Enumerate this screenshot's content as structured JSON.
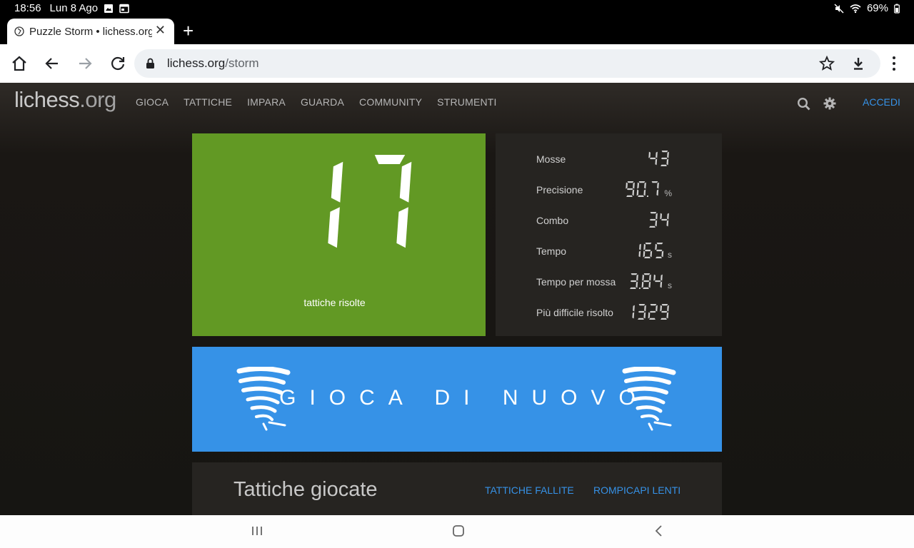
{
  "status_bar": {
    "time": "18:56",
    "date": "Lun 8 Ago",
    "battery": "69%"
  },
  "browser": {
    "tab_title": "Puzzle Storm • lichess.org",
    "url_host": "lichess.org",
    "url_path": "/storm"
  },
  "site": {
    "logo_main": "lichess",
    "logo_tld": ".org",
    "nav": [
      "GIOCA",
      "TATTICHE",
      "IMPARA",
      "GUARDA",
      "COMMUNITY",
      "STRUMENTI"
    ],
    "login": "ACCEDI"
  },
  "score": {
    "value": 17,
    "label": "tattiche risolte",
    "color": "#629924"
  },
  "stats": [
    {
      "label": "Mosse",
      "value": "43",
      "unit": ""
    },
    {
      "label": "Precisione",
      "value": "90.7",
      "unit": "%"
    },
    {
      "label": "Combo",
      "value": "34",
      "unit": ""
    },
    {
      "label": "Tempo",
      "value": "165",
      "unit": "s"
    },
    {
      "label": "Tempo per mossa",
      "value": "3.84",
      "unit": "s"
    },
    {
      "label": "Più difficile risolto",
      "value": "1329",
      "unit": ""
    }
  ],
  "play_again": {
    "label": "GIOCA DI NUOVO",
    "color": "#3692e7"
  },
  "played": {
    "title": "Tattiche giocate",
    "link_failed": "TATTICHE FALLITE",
    "link_slow": "ROMPICAPI LENTI"
  }
}
